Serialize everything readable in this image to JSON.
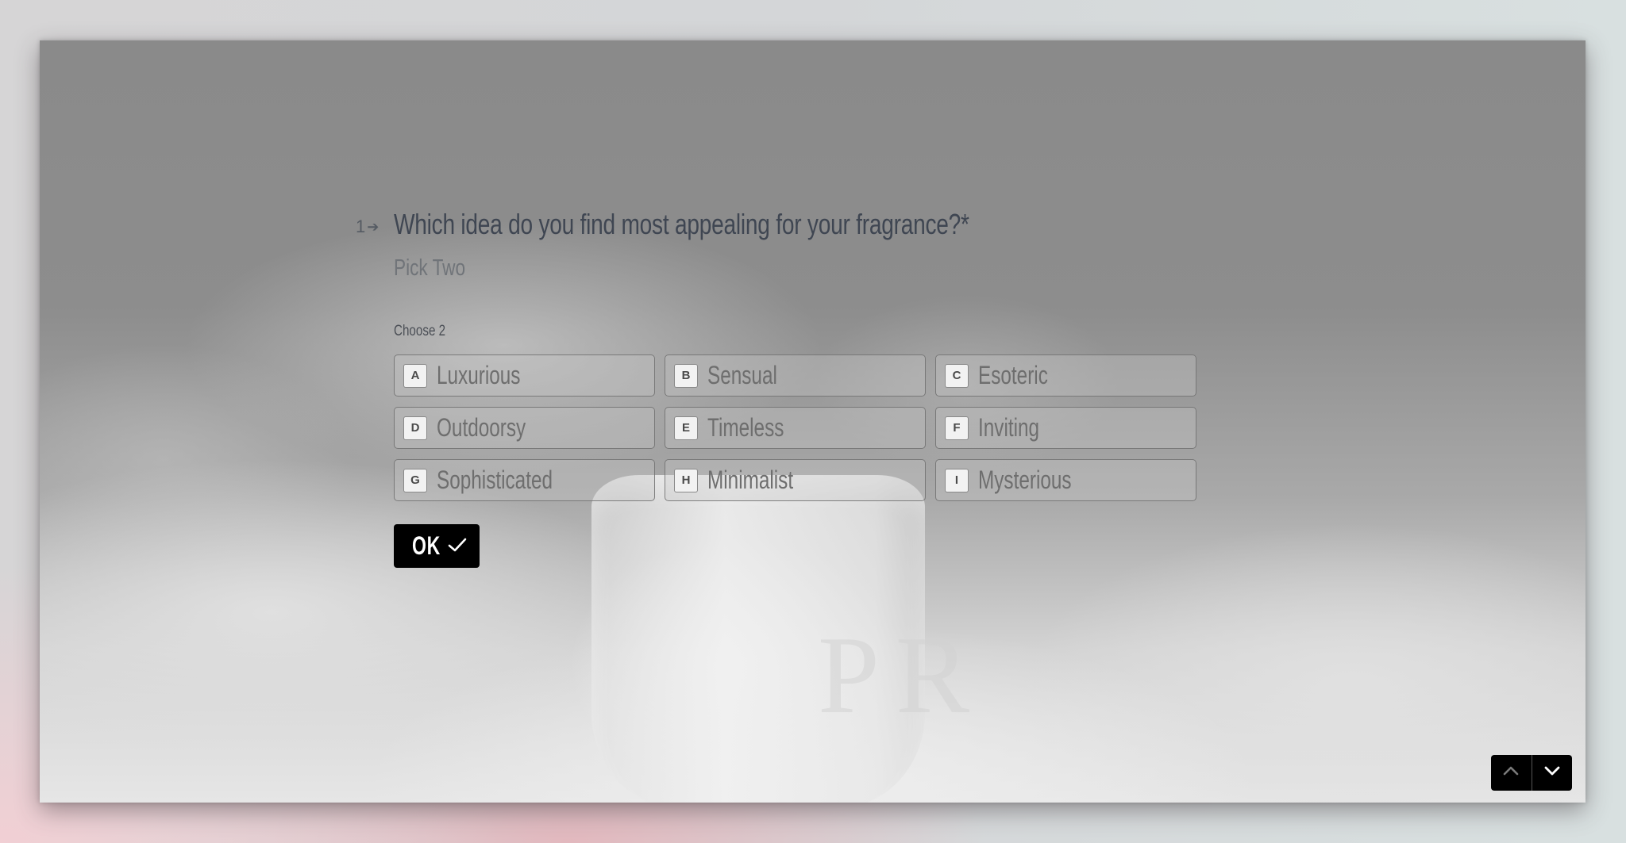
{
  "question": {
    "number": "1",
    "title": "Which idea do you find most appealing for your fragrance?*",
    "description": "Pick Two",
    "hint": "Choose 2",
    "choices": [
      {
        "key": "A",
        "label": "Luxurious"
      },
      {
        "key": "B",
        "label": "Sensual"
      },
      {
        "key": "C",
        "label": "Esoteric"
      },
      {
        "key": "D",
        "label": "Outdoorsy"
      },
      {
        "key": "E",
        "label": "Timeless"
      },
      {
        "key": "F",
        "label": "Inviting"
      },
      {
        "key": "G",
        "label": "Sophisticated"
      },
      {
        "key": "H",
        "label": "Minimalist"
      },
      {
        "key": "I",
        "label": "Mysterious"
      }
    ],
    "ok_label": "OK"
  },
  "background": {
    "logo_text": "PR"
  },
  "nav": {
    "up_icon": "chevron-up",
    "up_disabled": true,
    "down_icon": "chevron-down",
    "down_disabled": false
  },
  "colors": {
    "button_bg": "#000000",
    "title_text": "#3f4652",
    "choice_text": "#6e6e6e"
  }
}
